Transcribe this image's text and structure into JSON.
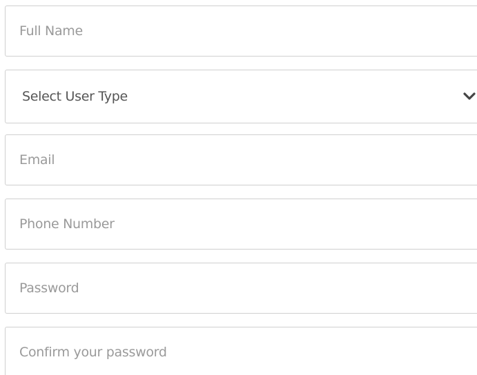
{
  "form": {
    "full_name": {
      "placeholder": "Full Name"
    },
    "user_type": {
      "selected": "Select User Type",
      "icon": "chevron-down-icon"
    },
    "email": {
      "placeholder": "Email"
    },
    "phone": {
      "placeholder": "Phone Number"
    },
    "password": {
      "placeholder": "Password"
    },
    "confirm_password": {
      "placeholder": "Confirm your password"
    }
  },
  "colors": {
    "border": "#cfcfcf",
    "placeholder": "#9a9a9a",
    "select_text": "#555555",
    "chevron": "#444444"
  }
}
